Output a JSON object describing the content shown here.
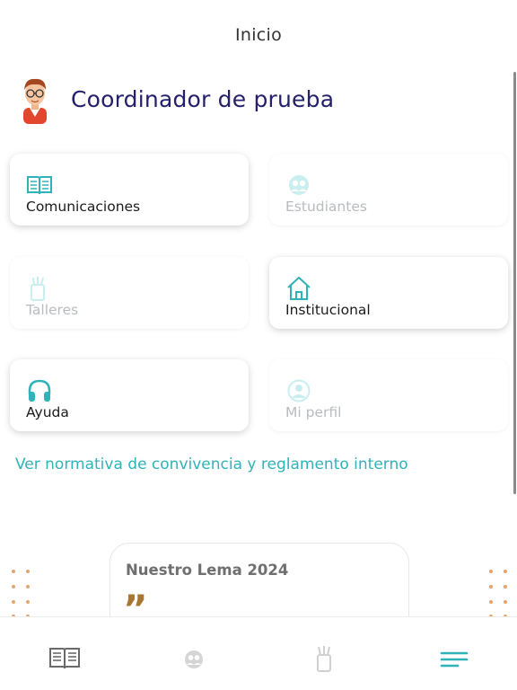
{
  "header": {
    "title": "Inicio"
  },
  "user": {
    "name": "Coordinador de prueba"
  },
  "menu": {
    "communications": {
      "label": "Comunicaciones",
      "icon": "book-icon",
      "enabled": true
    },
    "students": {
      "label": "Estudiantes",
      "icon": "students-icon",
      "enabled": false
    },
    "workshops": {
      "label": "Talleres",
      "icon": "pencil-cup-icon",
      "enabled": false
    },
    "institutional": {
      "label": "Institucional",
      "icon": "house-icon",
      "enabled": true
    },
    "help": {
      "label": "Ayuda",
      "icon": "headphones-icon",
      "enabled": true
    },
    "profile": {
      "label": "Mi perfil",
      "icon": "user-circle-icon",
      "enabled": false
    }
  },
  "regulation_link": "Ver normativa de convivencia y reglamento interno",
  "motto": {
    "title": "Nuestro Lema 2024",
    "quote_mark": "”"
  },
  "bottom_nav": [
    {
      "icon": "book-icon",
      "active": false
    },
    {
      "icon": "students-icon",
      "active": false
    },
    {
      "icon": "pencil-cup-icon",
      "active": false
    },
    {
      "icon": "menu-icon",
      "active": true
    }
  ],
  "colors": {
    "accent": "#2fb3b8",
    "title": "#24206b",
    "disabled": "#b8bcc0",
    "quote": "#a87630",
    "dots": "#e7a56b"
  }
}
